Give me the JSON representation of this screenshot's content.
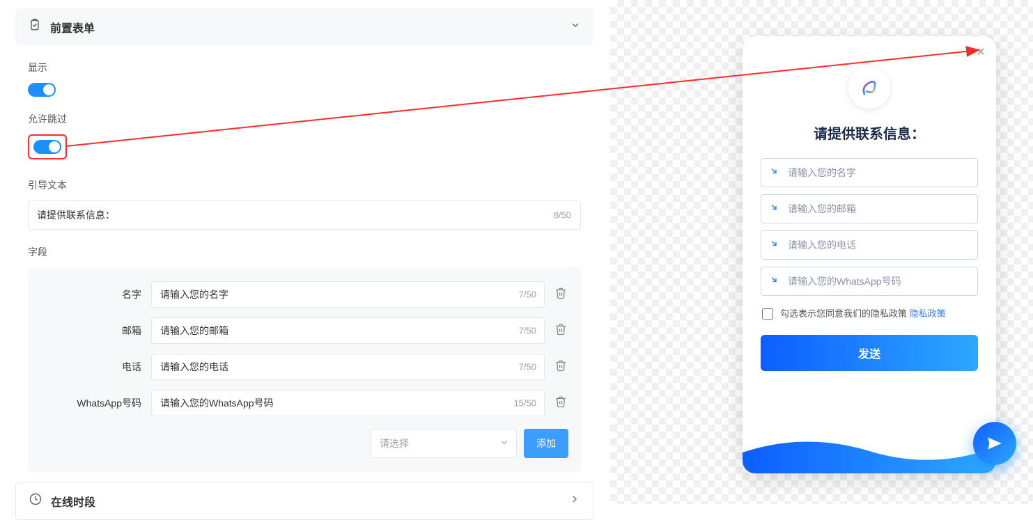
{
  "header": {
    "title": "前置表单"
  },
  "display": {
    "label": "显示"
  },
  "skip": {
    "label": "允许跳过"
  },
  "guide": {
    "label": "引导文本",
    "value": "请提供联系信息：",
    "counter": "8/50"
  },
  "fields": {
    "label": "字段",
    "rows": [
      {
        "label": "名字",
        "value": "请输入您的名字",
        "counter": "7/50"
      },
      {
        "label": "邮箱",
        "value": "请输入您的邮箱",
        "counter": "7/50"
      },
      {
        "label": "电话",
        "value": "请输入您的电话",
        "counter": "7/50"
      },
      {
        "label": "WhatsApp号码",
        "value": "请输入您的WhatsApp号码",
        "counter": "15/50"
      }
    ],
    "select_placeholder": "请选择",
    "add_label": "添加"
  },
  "footer": {
    "title": "在线时段"
  },
  "preview": {
    "title": "请提供联系信息：",
    "inputs": [
      "请输入您的名字",
      "请输入您的邮箱",
      "请输入您的电话",
      "请输入您的WhatsApp号码"
    ],
    "consent_text": "勾选表示您同意我们的隐私政策 ",
    "consent_link": "隐私政策",
    "send": "发送"
  }
}
